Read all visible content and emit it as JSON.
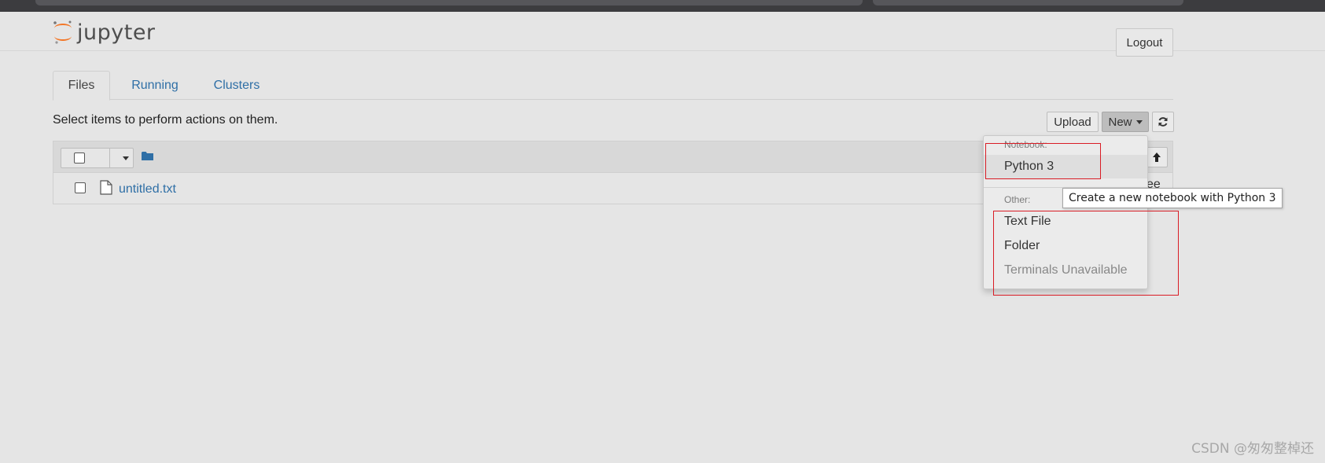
{
  "app": {
    "name": "jupyter",
    "logout_label": "Logout"
  },
  "tabs": [
    {
      "label": "Files",
      "active": true
    },
    {
      "label": "Running",
      "active": false
    },
    {
      "label": "Clusters",
      "active": false
    }
  ],
  "toolbar": {
    "hint": "Select items to perform actions on them.",
    "upload_label": "Upload",
    "new_label": "New",
    "refresh_icon": "refresh-icon"
  },
  "file_list": {
    "header_icon": "folder-icon",
    "rows": [
      {
        "name": "untitled.txt",
        "icon": "file-icon",
        "trailing_text": "ee"
      }
    ]
  },
  "new_menu": {
    "notebook_header": "Notebook:",
    "notebook_items": [
      "Python 3"
    ],
    "other_header": "Other:",
    "other_items": [
      "Text File",
      "Folder"
    ],
    "disabled_item": "Terminals Unavailable"
  },
  "tooltip": "Create a new notebook with Python 3",
  "watermark": "CSDN @匆匆整棹还",
  "colors": {
    "link": "#2f6fa6",
    "logo_orange": "#f37626",
    "highlight_box": "#d91c25"
  }
}
